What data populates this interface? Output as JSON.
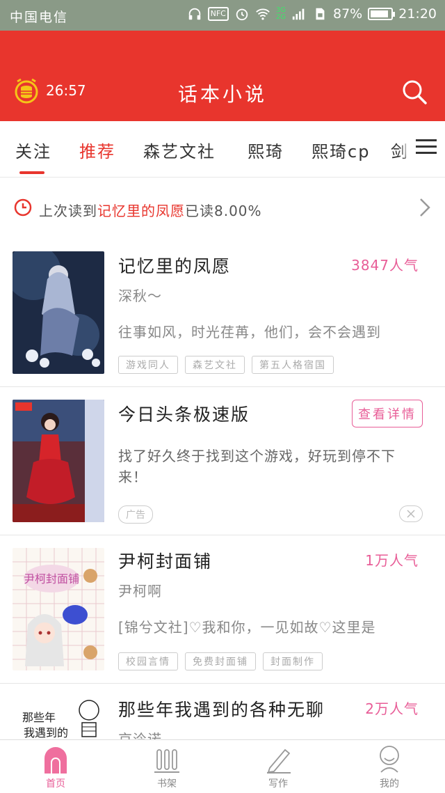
{
  "statusbar": {
    "carrier": "中国电信",
    "net_3g": "3G",
    "net_2g": "2G",
    "nfc": "NFC",
    "battery": "87%",
    "battery_level": 0.87,
    "time": "21:20"
  },
  "header": {
    "timer": "26:57",
    "title": "话本小说"
  },
  "tabs": [
    {
      "label": "关注"
    },
    {
      "label": "推荐"
    },
    {
      "label": "森艺文社"
    },
    {
      "label": "熙琦"
    },
    {
      "label": "熙琦cp"
    },
    {
      "label": "剑"
    }
  ],
  "history": {
    "prefix": "上次读到",
    "book": "记忆里的凤愿",
    "suffix": "已读8.00%"
  },
  "cards": [
    {
      "title": "记忆里的凤愿",
      "popularity": "3847人气",
      "author": "深秋～",
      "desc": "往事如风，时光荏苒，他们，会不会遇到",
      "tags": [
        "游戏同人",
        "森艺文社",
        "第五人格宿国"
      ]
    },
    {
      "title": "今日头条极速版",
      "button": "查看详情",
      "desc": "找了好久终于找到这个游戏，好玩到停不下来！",
      "ad_label": "广告"
    },
    {
      "title": "尹柯封面铺",
      "popularity": "1万人气",
      "author": "尹柯啊",
      "desc": "[锦兮文社]♡我和你，一见如故♡这里是",
      "tags": [
        "校园言情",
        "免费封面铺",
        "封面制作"
      ],
      "cover_text": "尹柯封面铺"
    },
    {
      "title": "那些年我遇到的各种无聊",
      "popularity": "2万人气",
      "author": "京泠诺",
      "cover_text_1": "那些年",
      "cover_text_2": "我遇到的"
    }
  ],
  "nav": [
    {
      "label": "首页"
    },
    {
      "label": "书架"
    },
    {
      "label": "写作"
    },
    {
      "label": "我的"
    }
  ],
  "colors": {
    "primary": "#e8352d",
    "accent": "#e85d97",
    "statusbar": "#8a9a87"
  }
}
